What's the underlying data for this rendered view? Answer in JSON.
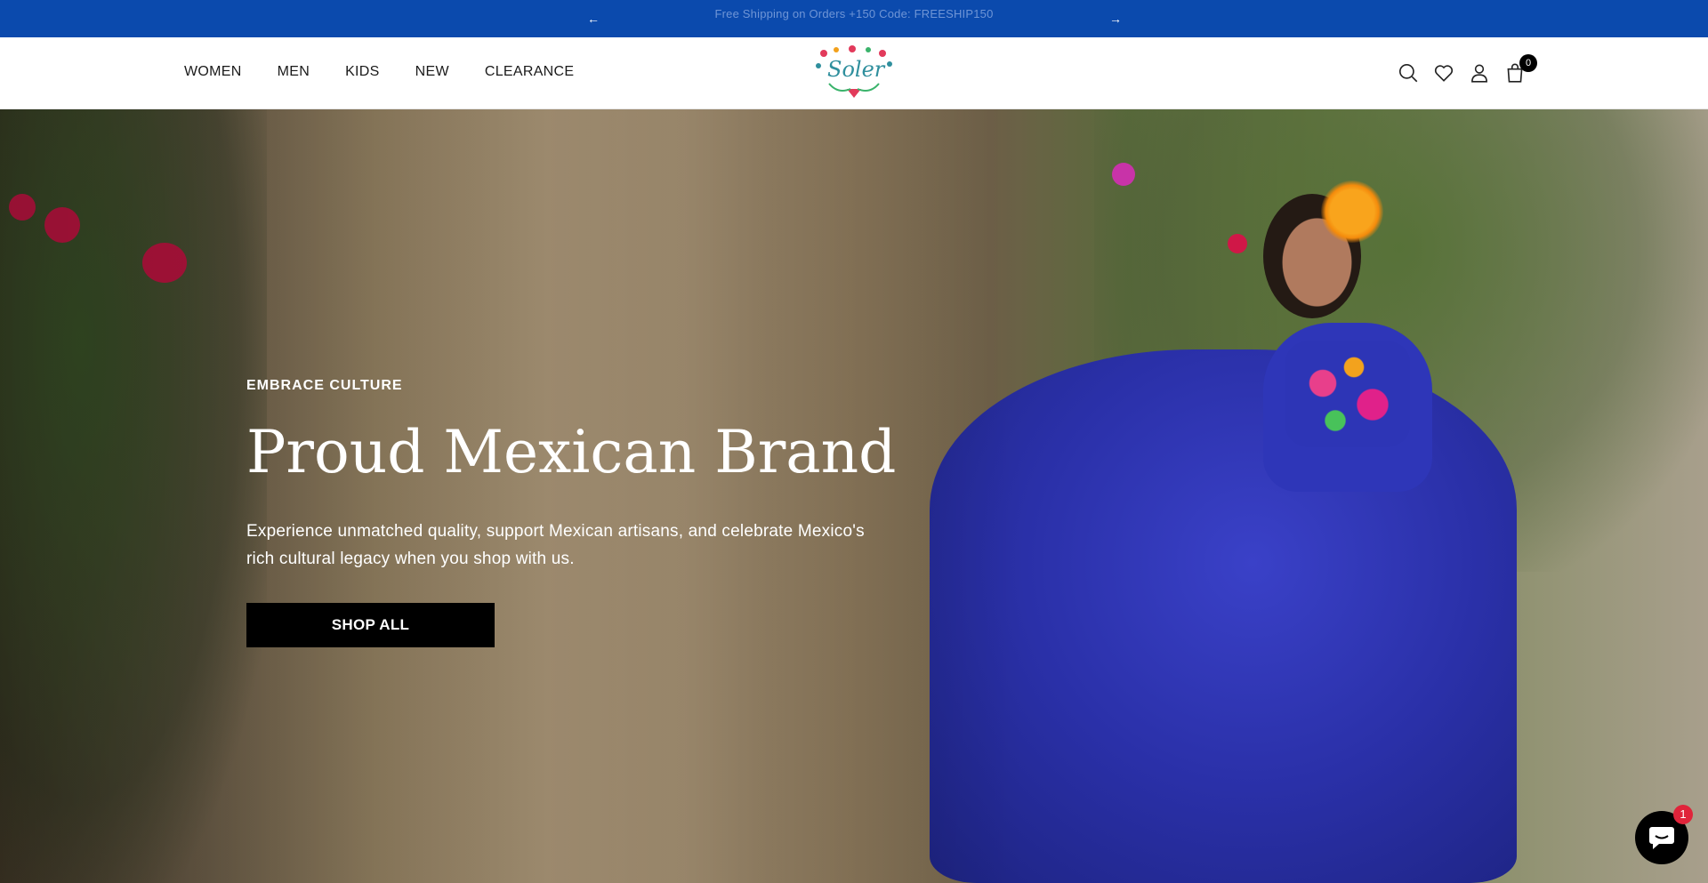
{
  "announcement": {
    "prev_label": "←",
    "message": "Free Shipping on Orders +150 Code: FREESHIP150",
    "next_label": "→",
    "background": "#0b4aad"
  },
  "header": {
    "nav": [
      {
        "label": "WOMEN"
      },
      {
        "label": "MEN"
      },
      {
        "label": "KIDS"
      },
      {
        "label": "NEW"
      },
      {
        "label": "CLEARANCE"
      }
    ],
    "logo_text": "Soler",
    "icons": [
      "search-icon",
      "heart-icon",
      "account-icon",
      "cart-icon"
    ],
    "cart_count": "0"
  },
  "hero": {
    "eyebrow": "EMBRACE CULTURE",
    "headline": "Proud Mexican Brand",
    "subtext": "Experience unmatched quality, support Mexican artisans, and celebrate Mexico's rich cultural legacy when you shop with us.",
    "cta_label": "SHOP ALL"
  },
  "chat": {
    "badge_count": "1",
    "icon": "chat-icon"
  }
}
